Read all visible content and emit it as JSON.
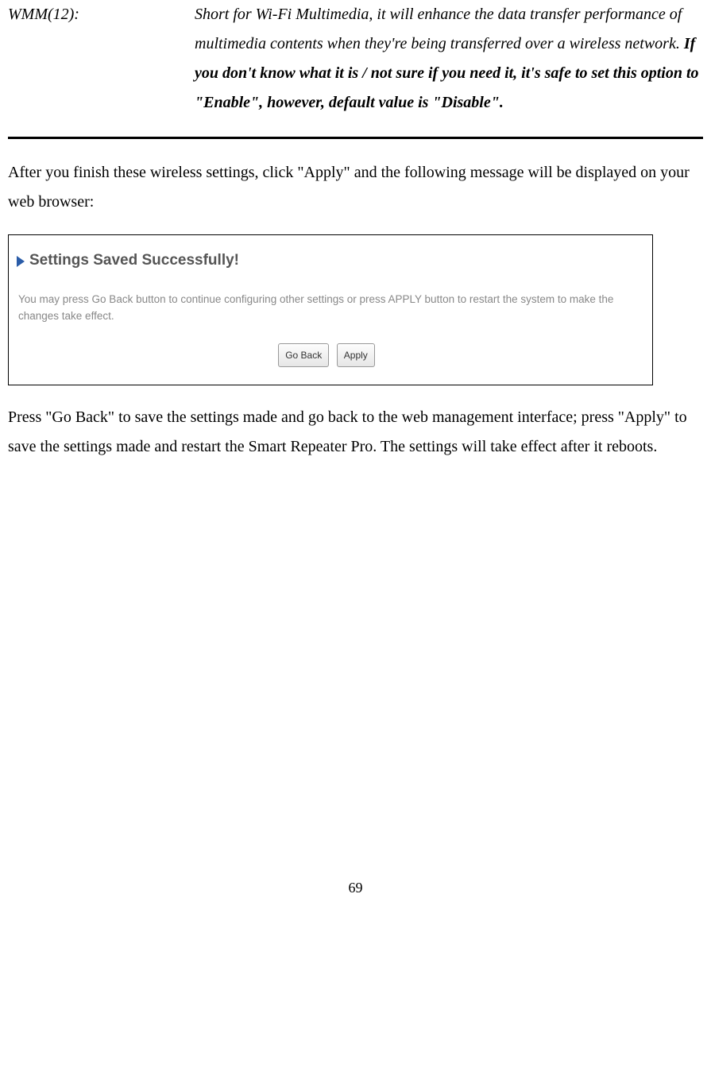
{
  "definition": {
    "term": "WMM(12):",
    "desc_plain": "Short for Wi-Fi Multimedia, it will enhance the data transfer performance of multimedia contents when they're being transferred over a wireless network. ",
    "desc_bold": "If you don't know what it is / not sure if you need it, it's safe to set this option to \"Enable\", however, default value is \"Disable\"."
  },
  "para1": "After you finish these wireless settings, click \"Apply\" and the following message will be displayed on your web browser:",
  "screenshot": {
    "heading": "Settings Saved Successfully!",
    "body": "You may press Go Back button to continue configuring other settings or press APPLY button to restart the system to make the changes take effect.",
    "btn_goback": "Go Back",
    "btn_apply": "Apply"
  },
  "para2": "Press \"Go Back\" to save the settings made and go back to the web management interface; press \"Apply\" to save the settings made and restart the Smart Repeater Pro.    The settings will take effect after it reboots.",
  "page_number": "69"
}
